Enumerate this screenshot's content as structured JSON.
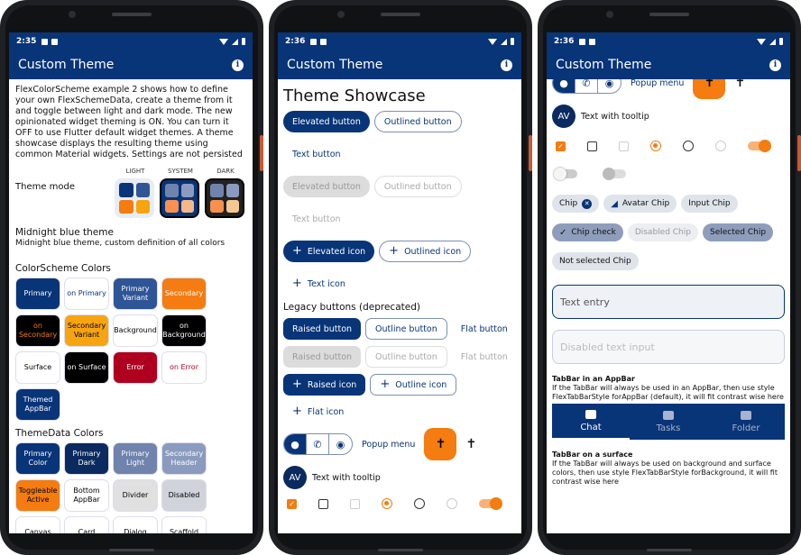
{
  "screens": [
    {
      "time": "2:35",
      "title": "Custom Theme"
    },
    {
      "time": "2:36",
      "title": "Custom Theme"
    },
    {
      "time": "2:36",
      "title": "Custom Theme"
    }
  ],
  "info_glyph": "i",
  "screen1": {
    "intro": "FlexColorScheme example 2 shows how to define your own FlexSchemeData, create a theme from it and toggle between light and dark mode. The new opinionated widget theming is ON. You can turn it OFF to use Flutter default widget themes. A theme showcase displays the resulting theme using common Material widgets. Settings are not persisted",
    "theme_mode_label": "Theme mode",
    "mode_light": "LIGHT",
    "mode_system": "SYSTEM",
    "mode_dark": "DARK",
    "scheme_title": "Midnight blue theme",
    "scheme_desc": "Midnight blue theme, custom definition of all colors",
    "colorscheme_title": "ColorScheme Colors",
    "colorscheme_chips": [
      {
        "label": "Primary",
        "bg": "#083478",
        "fg": "#ffffff"
      },
      {
        "label": "on Primary",
        "bg": "#ffffff",
        "fg": "#083478"
      },
      {
        "label": "Primary Variant",
        "bg": "#2e5596",
        "fg": "#ffffff"
      },
      {
        "label": "Secondary",
        "bg": "#f47c10",
        "fg": "#ffffff"
      },
      {
        "label": "on Secondary",
        "bg": "#000000",
        "fg": "#f47c10"
      },
      {
        "label": "Secondary Variant",
        "bg": "#f7a410",
        "fg": "#000000"
      },
      {
        "label": "Background",
        "bg": "#ffffff",
        "fg": "#000000"
      },
      {
        "label": "on Background",
        "bg": "#000000",
        "fg": "#ffffff"
      },
      {
        "label": "Surface",
        "bg": "#ffffff",
        "fg": "#000000"
      },
      {
        "label": "on Surface",
        "bg": "#000000",
        "fg": "#ffffff"
      },
      {
        "label": "Error",
        "bg": "#b00020",
        "fg": "#ffffff"
      },
      {
        "label": "on Error",
        "bg": "#ffffff",
        "fg": "#b00020"
      },
      {
        "label": "Themed AppBar",
        "bg": "#083478",
        "fg": "#ffffff"
      }
    ],
    "themedata_title": "ThemeData Colors",
    "themedata_chips": [
      {
        "label": "Primary Color",
        "bg": "#083478",
        "fg": "#ffffff"
      },
      {
        "label": "Primary Dark",
        "bg": "#0a2a60",
        "fg": "#ffffff"
      },
      {
        "label": "Primary Light",
        "bg": "#6f83ad",
        "fg": "#ffffff"
      },
      {
        "label": "Secondary Header",
        "bg": "#8a9bbf",
        "fg": "#ffffff"
      },
      {
        "label": "Toggleable Active",
        "bg": "#f47c10",
        "fg": "#000000"
      },
      {
        "label": "Bottom AppBar",
        "bg": "#ffffff",
        "fg": "#000000"
      },
      {
        "label": "Divider",
        "bg": "#e0e0e0",
        "fg": "#000000"
      },
      {
        "label": "Disabled",
        "bg": "#d0d4da",
        "fg": "#000000"
      },
      {
        "label": "Canvas",
        "bg": "#ffffff",
        "fg": "#000000"
      },
      {
        "label": "Card",
        "bg": "#ffffff",
        "fg": "#000000"
      },
      {
        "label": "Dialog",
        "bg": "#ffffff",
        "fg": "#000000"
      },
      {
        "label": "Scaffold",
        "bg": "#ffffff",
        "fg": "#000000"
      }
    ]
  },
  "screen2": {
    "heading": "Theme Showcase",
    "elevated_button": "Elevated button",
    "outlined_button": "Outlined button",
    "text_button": "Text button",
    "elevated_icon": "Elevated icon",
    "outlined_icon": "Outlined icon",
    "text_icon": "Text icon",
    "legacy_title": "Legacy buttons (deprecated)",
    "raised_button": "Raised button",
    "outline_button": "Outline button",
    "flat_button": "Flat button",
    "raised_icon": "Raised icon",
    "outline_icon": "Outline icon",
    "flat_icon": "Flat icon",
    "popup_menu": "Popup menu",
    "avatar_text": "AV",
    "tooltip_text": "Text with tooltip"
  },
  "screen3": {
    "popup_menu": "Popup menu",
    "avatar_text": "AV",
    "tooltip_text": "Text with tooltip",
    "chip": "Chip",
    "avatar_chip": "Avatar Chip",
    "input_chip": "Input Chip",
    "chip_check": "Chip check",
    "disabled_chip": "Disabled Chip",
    "selected_chip": "Selected Chip",
    "not_selected_chip": "Not selected Chip",
    "text_entry": "Text entry",
    "disabled_text_input": "Disabled text input",
    "tabbar_appbar_title": "TabBar in an AppBar",
    "tabbar_appbar_desc": "If the TabBar will always be used in an AppBar, then use style FlexTabBarStyle forAppBar (default), it will fit contrast wise here",
    "tabs": [
      "Chat",
      "Tasks",
      "Folder"
    ],
    "tabbar_surface_title": "TabBar on a surface",
    "tabbar_surface_desc": "If the TabBar will always be used on background and surface colors, then use style FlexTabBarStyle forBackground, it will fit contrast wise here"
  }
}
